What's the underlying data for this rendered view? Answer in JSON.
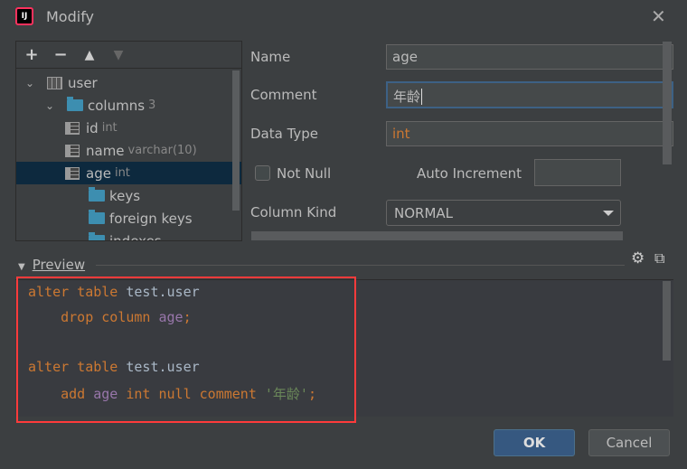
{
  "window": {
    "title": "Modify",
    "app_icon": "IJ",
    "close": "✕"
  },
  "toolbar": {
    "add": "+",
    "remove": "−",
    "up": "▲",
    "down": "▼"
  },
  "tree": [
    {
      "label": "user",
      "hint": "",
      "icon": "table-icon",
      "level": 0,
      "expanded": true
    },
    {
      "label": "columns",
      "hint": "3",
      "icon": "folder-icon",
      "level": 1,
      "expanded": true
    },
    {
      "label": "id",
      "hint": "int",
      "icon": "column-icon",
      "level": 2
    },
    {
      "label": "name",
      "hint": "varchar(10)",
      "icon": "column-icon",
      "level": 2
    },
    {
      "label": "age",
      "hint": "int",
      "icon": "column-icon",
      "level": 2,
      "selected": true
    },
    {
      "label": "keys",
      "hint": "",
      "icon": "folder-icon",
      "level": 1
    },
    {
      "label": "foreign keys",
      "hint": "",
      "icon": "folder-icon",
      "level": 1
    },
    {
      "label": "indexes",
      "hint": "",
      "icon": "folder-icon",
      "level": 1
    }
  ],
  "form": {
    "name_label": "Name",
    "name_value": "age",
    "comment_label": "Comment",
    "comment_value": "年龄",
    "type_label": "Data Type",
    "type_value": "int",
    "notnull_label": "Not Null",
    "notnull_checked": false,
    "autoinc_label": "Auto Increment",
    "kind_label": "Column Kind",
    "kind_value": "NORMAL"
  },
  "preview": {
    "label": "Preview",
    "lines": [
      [
        {
          "t": "alter table ",
          "c": "kw"
        },
        {
          "t": "test.user",
          "c": "id"
        }
      ],
      [
        {
          "t": "    drop column ",
          "c": "kw"
        },
        {
          "t": "age",
          "c": "col"
        },
        {
          "t": ";",
          "c": "kw"
        }
      ],
      [],
      [
        {
          "t": "alter table ",
          "c": "kw"
        },
        {
          "t": "test.user",
          "c": "id"
        }
      ],
      [
        {
          "t": "    add ",
          "c": "kw"
        },
        {
          "t": "age",
          "c": "col"
        },
        {
          "t": " int null comment ",
          "c": "kw"
        },
        {
          "t": "'年龄'",
          "c": "str"
        },
        {
          "t": ";",
          "c": "kw"
        }
      ]
    ]
  },
  "buttons": {
    "ok": "OK",
    "cancel": "Cancel"
  },
  "colors": {
    "highlight": "#ff3b3b",
    "keyword": "#cc7832",
    "string": "#6a8759",
    "column": "#9876aa"
  }
}
